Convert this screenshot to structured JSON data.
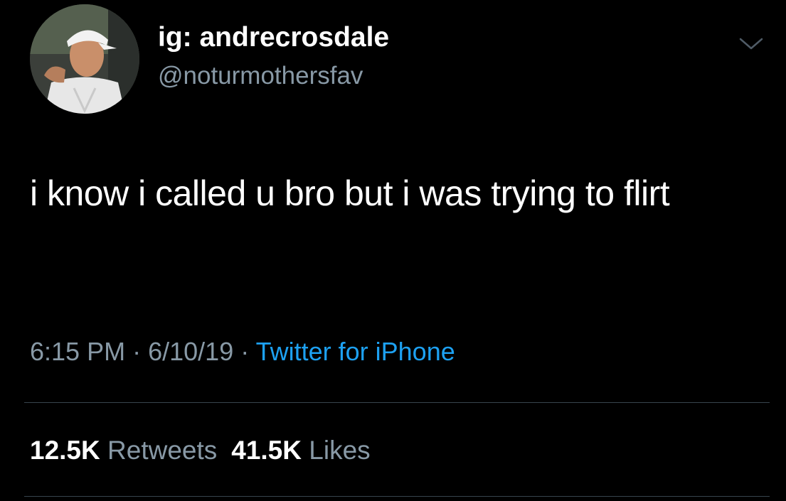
{
  "tweet": {
    "author": {
      "display_name": "ig: andrecrosdale",
      "handle": "@noturmothersfav",
      "avatar_icon": "profile-photo"
    },
    "text": "i know i called u bro but i was trying to flirt",
    "time": "6:15 PM",
    "date": "6/10/19",
    "separator": "·",
    "source": "Twitter for iPhone",
    "retweets": {
      "count": "12.5K",
      "label": "Retweets"
    },
    "likes": {
      "count": "41.5K",
      "label": "Likes"
    }
  },
  "colors": {
    "background": "#000000",
    "primary_text": "#ffffff",
    "secondary_text": "#8899a6",
    "link": "#1da1f2",
    "divider": "#38444d"
  },
  "icons": {
    "menu": "chevron-down-icon"
  }
}
